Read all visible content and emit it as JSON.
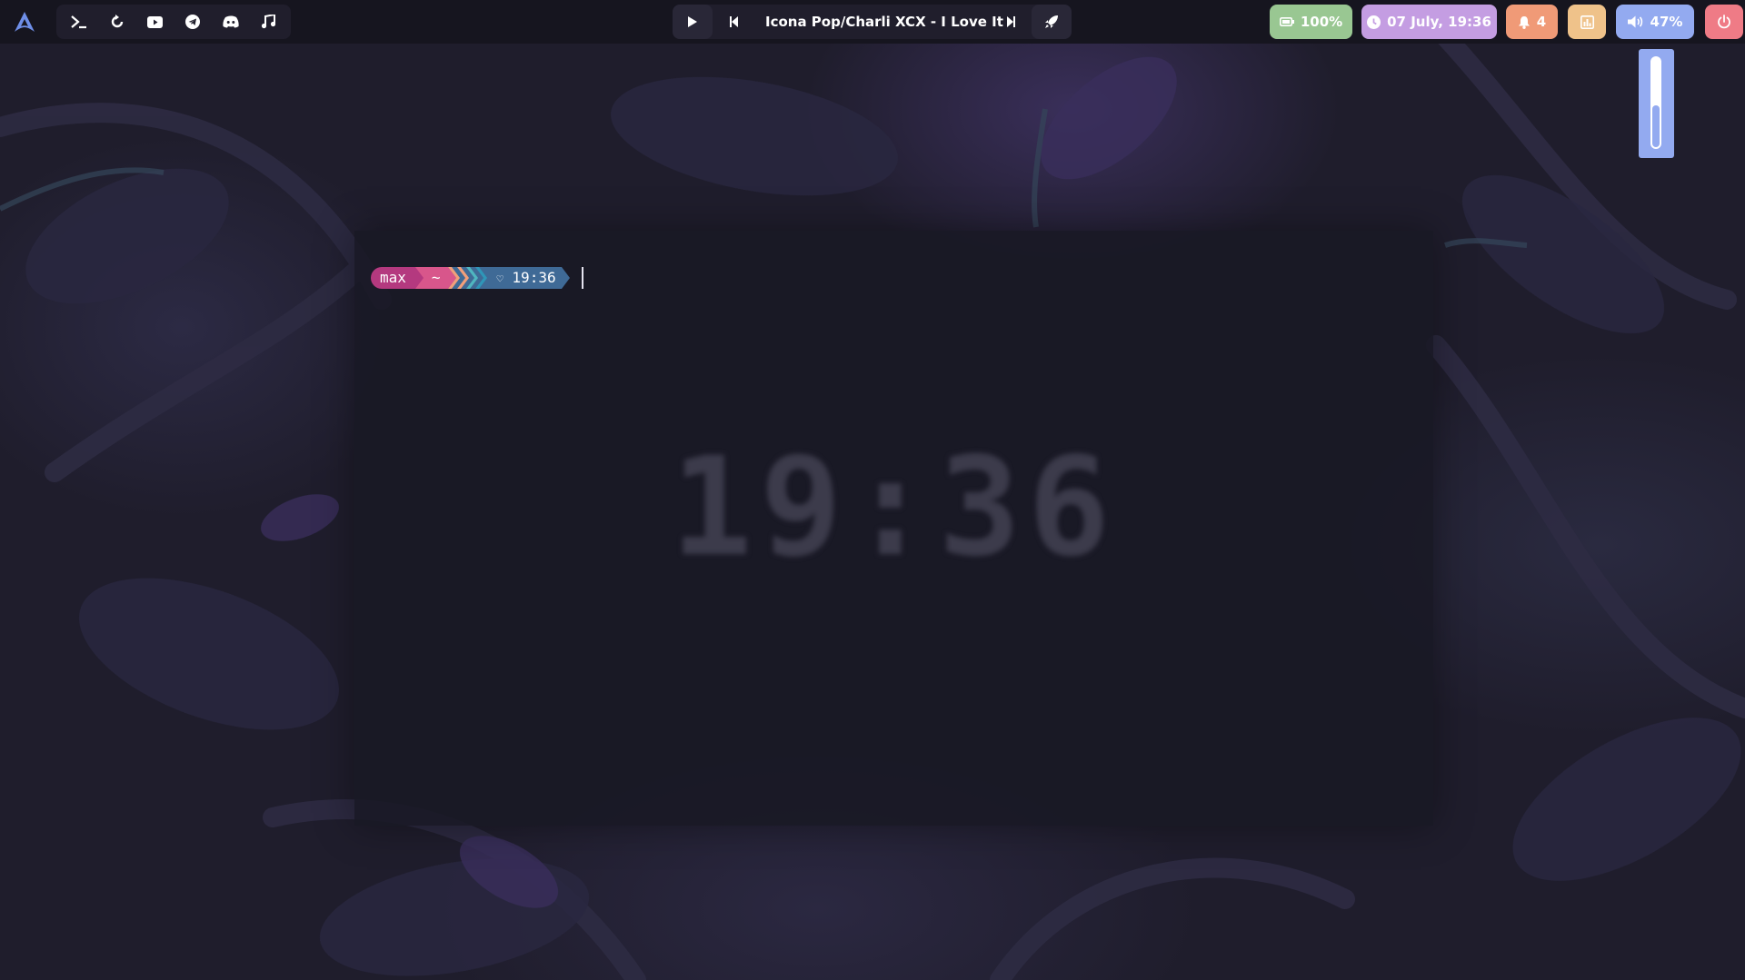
{
  "launcher": {
    "icons": [
      "terminal-icon",
      "refresh-icon",
      "youtube-icon",
      "telegram-icon",
      "discord-icon",
      "music-note-icon"
    ]
  },
  "player": {
    "track": "Icona Pop/Charli XCX - I Love It",
    "icons": [
      "play-icon",
      "previous-icon",
      "next-icon",
      "rocket-icon"
    ]
  },
  "status": {
    "battery": {
      "label": "100%",
      "color": "#99c792",
      "icon": "battery-icon"
    },
    "clock": {
      "label": "07 July, 19:36",
      "color": "#c49de2",
      "icon": "clock-icon"
    },
    "notifications": {
      "label": "4",
      "color": "#f09a77",
      "icon": "bell-icon"
    },
    "stats": {
      "color": "#efc28a",
      "icon": "bar-chart-icon"
    },
    "volume": {
      "label": "47%",
      "color": "#93aaf0",
      "icon": "speaker-icon",
      "level": 0.47
    },
    "power": {
      "color": "#ef7b86",
      "icon": "power-icon"
    }
  },
  "terminal": {
    "prompt": {
      "user": "max",
      "dir": "~",
      "time": "19:36",
      "user_color": "#b4397f",
      "dir_color": "#d8568b",
      "time_color": "#3f6a96"
    },
    "big_clock": "19:36"
  }
}
